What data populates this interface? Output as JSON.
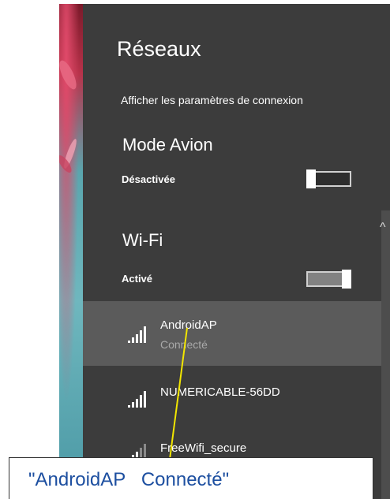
{
  "panel": {
    "title": "Réseaux",
    "connection_settings_link": "Afficher les paramètres de connexion"
  },
  "airplane_mode": {
    "heading": "Mode Avion",
    "state_label": "Désactivée",
    "on": false
  },
  "wifi": {
    "heading": "Wi-Fi",
    "state_label": "Activé",
    "on": true
  },
  "networks": [
    {
      "name": "AndroidAP",
      "status": "Connecté",
      "selected": true,
      "icon": "wifi-signal-icon"
    },
    {
      "name": "NUMERICABLE-56DD",
      "status": "",
      "selected": false,
      "icon": "wifi-signal-icon"
    },
    {
      "name": "FreeWifi_secure",
      "status": "",
      "selected": false,
      "icon": "wifi-signal-icon"
    }
  ],
  "annotation": {
    "text": "\"AndroidAP   Connecté\"",
    "color": "#1d4fa0",
    "arrow_color": "#f2e600"
  }
}
